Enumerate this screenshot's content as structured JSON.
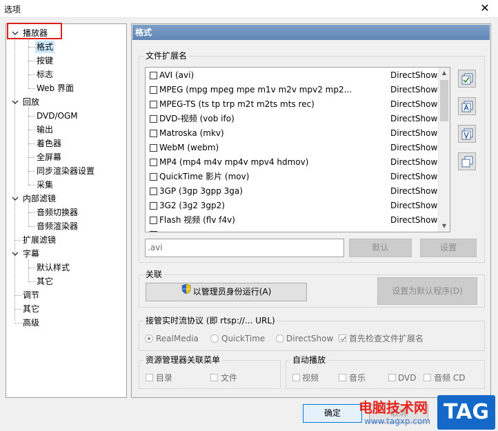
{
  "window": {
    "title": "选项",
    "close_glyph": "✕"
  },
  "tree": {
    "items": [
      {
        "label": "播放器",
        "level": 0,
        "expanded": true
      },
      {
        "label": "格式",
        "level": 1,
        "selected": true
      },
      {
        "label": "按键",
        "level": 1
      },
      {
        "label": "标志",
        "level": 1
      },
      {
        "label": "Web 界面",
        "level": 1
      },
      {
        "label": "回放",
        "level": 0,
        "expanded": true
      },
      {
        "label": "DVD/OGM",
        "level": 1
      },
      {
        "label": "输出",
        "level": 1
      },
      {
        "label": "着色器",
        "level": 1
      },
      {
        "label": "全屏幕",
        "level": 1
      },
      {
        "label": "同步渲染器设置",
        "level": 1
      },
      {
        "label": "采集",
        "level": 1
      },
      {
        "label": "内部滤镜",
        "level": 0,
        "expanded": true
      },
      {
        "label": "音频切换器",
        "level": 1
      },
      {
        "label": "音频渲染器",
        "level": 1
      },
      {
        "label": "扩展滤镜",
        "level": 0
      },
      {
        "label": "字幕",
        "level": 0,
        "expanded": true
      },
      {
        "label": "默认样式",
        "level": 1
      },
      {
        "label": "其它",
        "level": 1
      },
      {
        "label": "调节",
        "level": 0
      },
      {
        "label": "其它",
        "level": 0
      },
      {
        "label": "高级",
        "level": 0
      }
    ]
  },
  "panel": {
    "header": "格式",
    "extensions_group": {
      "title": "文件扩展名",
      "rows": [
        {
          "name": "AVI (avi)",
          "decoder": "DirectShow"
        },
        {
          "name": "MPEG (mpg mpeg mpe m1v m2v mpv2 mp2...",
          "decoder": "DirectShow"
        },
        {
          "name": "MPEG-TS (ts tp trp m2t m2ts mts rec)",
          "decoder": "DirectShow"
        },
        {
          "name": "DVD-视频 (vob ifo)",
          "decoder": "DirectShow"
        },
        {
          "name": "Matroska (mkv)",
          "decoder": "DirectShow"
        },
        {
          "name": "WebM (webm)",
          "decoder": "DirectShow"
        },
        {
          "name": "MP4 (mp4 m4v mp4v mpv4 hdmov)",
          "decoder": "DirectShow"
        },
        {
          "name": "QuickTime 影片 (mov)",
          "decoder": "DirectShow"
        },
        {
          "name": "3GP (3gp 3gpp 3ga)",
          "decoder": "DirectShow"
        },
        {
          "name": "3G2 (3g2 3gp2)",
          "decoder": "DirectShow"
        },
        {
          "name": "Flash 视频 (flv f4v)",
          "decoder": "DirectShow"
        },
        {
          "name": "",
          "decoder": ""
        }
      ],
      "extension_value": ".avi",
      "default_button": "默认",
      "settings_button": "设置"
    },
    "association_group": {
      "title": "关联",
      "run_as_admin_button": "以管理员身份运行(A)",
      "set_default_button": "设置为默认程序(D)"
    },
    "rtsp_group": {
      "title": "接管实时流协议 (即 rtsp://... URL)",
      "options": [
        {
          "label": "RealMedia",
          "checked": true
        },
        {
          "label": "QuickTime",
          "checked": false
        },
        {
          "label": "DirectShow",
          "checked": false
        }
      ],
      "check_ext_label": "首先检查文件扩展名",
      "check_ext_checked": true
    },
    "explorer_group": {
      "title": "资源管理器关联菜单",
      "items": [
        "目录",
        "文件"
      ]
    },
    "autoplay_group": {
      "title": "自动播放",
      "items": [
        "视频",
        "音乐",
        "DVD",
        "音频 CD"
      ]
    }
  },
  "footer": {
    "ok_button": "确定",
    "cancel_button": "取消"
  },
  "watermark": {
    "site_name": "电脑技术网",
    "url": "www.tagxp.com",
    "tag": "TAG"
  },
  "colors": {
    "header_blue": "#5f86b6",
    "highlight_red": "#e0201a",
    "selected_bg": "#cce8ff"
  }
}
